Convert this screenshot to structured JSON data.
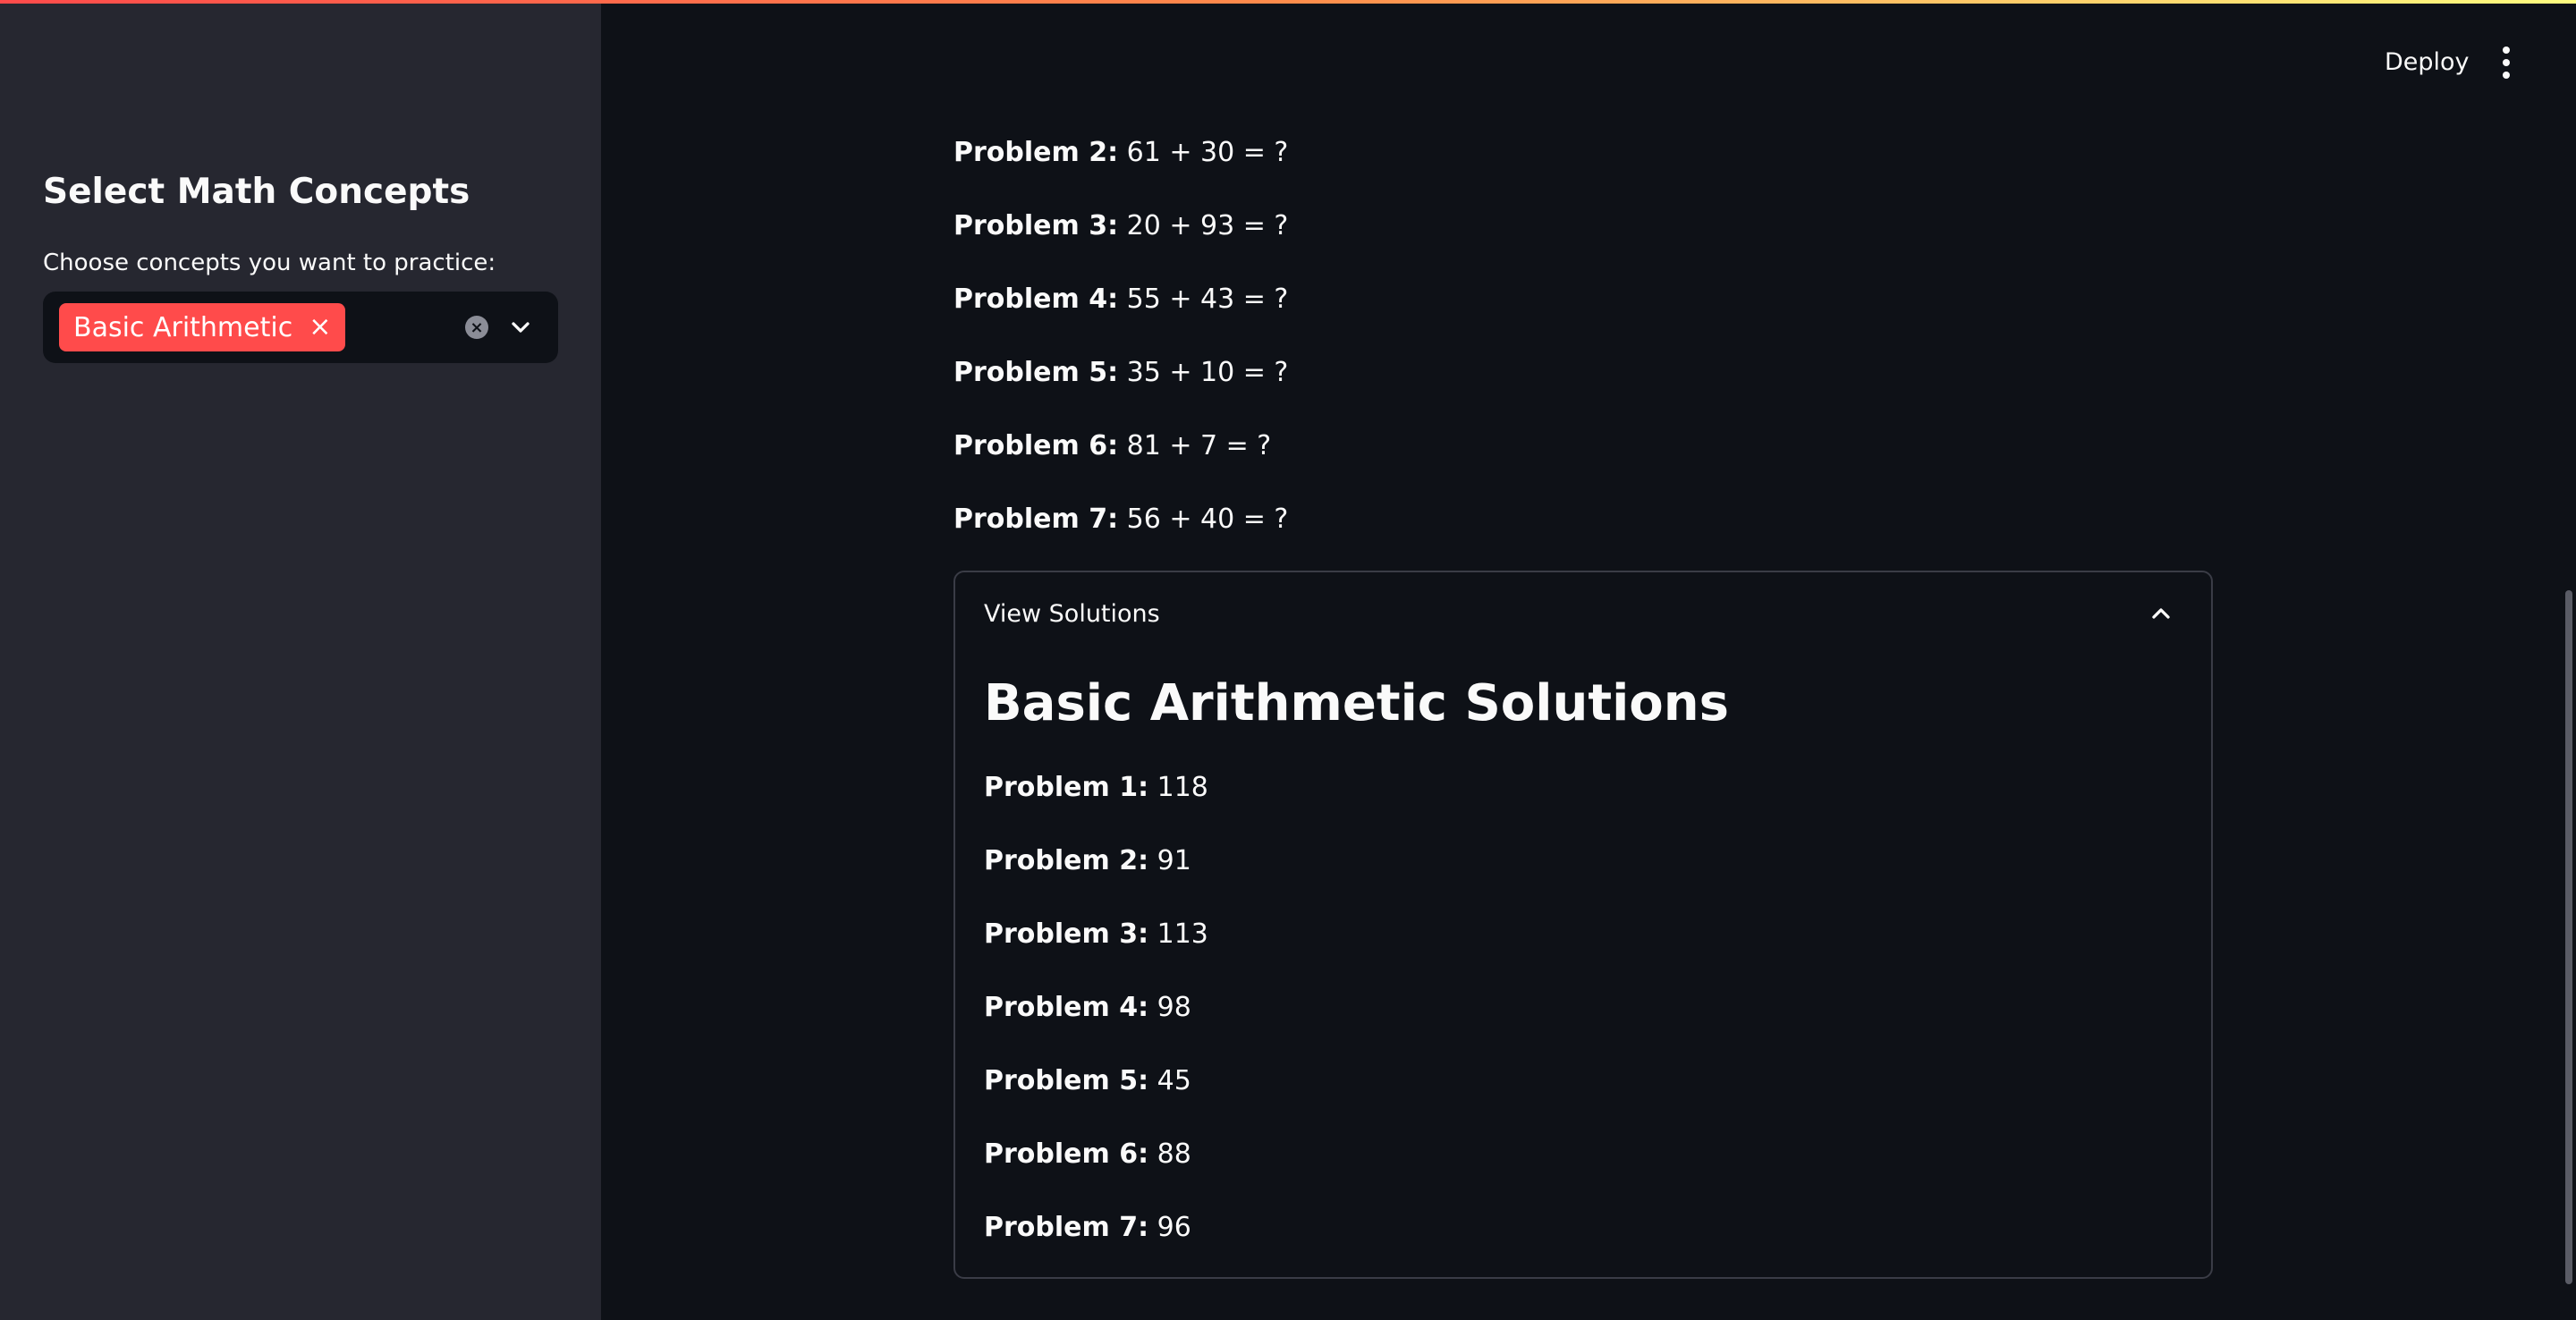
{
  "colors": {
    "accent": "#ff4b4b",
    "background": "#0e1117",
    "sidebar": "#262730"
  },
  "sidebar": {
    "title": "Select Math Concepts",
    "select_label": "Choose concepts you want to practice:",
    "selected_tags": [
      "Basic Arithmetic"
    ],
    "tag_remove_symbol": "×",
    "clear_icon": "clear-circle-icon",
    "dropdown_icon": "chevron-down-icon"
  },
  "header": {
    "deploy_label": "Deploy",
    "menu_icon": "vertical-ellipsis-icon"
  },
  "problems": [
    {
      "label": "Problem 2:",
      "text": "61 + 30 = ?"
    },
    {
      "label": "Problem 3:",
      "text": "20 + 93 = ?"
    },
    {
      "label": "Problem 4:",
      "text": "55 + 43 = ?"
    },
    {
      "label": "Problem 5:",
      "text": "35 + 10 = ?"
    },
    {
      "label": "Problem 6:",
      "text": "81 + 7 = ?"
    },
    {
      "label": "Problem 7:",
      "text": "56 + 40 = ?"
    }
  ],
  "expander": {
    "title": "View Solutions",
    "expanded": true,
    "heading": "Basic Arithmetic Solutions",
    "solutions": [
      {
        "label": "Problem 1:",
        "answer": "118"
      },
      {
        "label": "Problem 2:",
        "answer": "91"
      },
      {
        "label": "Problem 3:",
        "answer": "113"
      },
      {
        "label": "Problem 4:",
        "answer": "98"
      },
      {
        "label": "Problem 5:",
        "answer": "45"
      },
      {
        "label": "Problem 6:",
        "answer": "88"
      },
      {
        "label": "Problem 7:",
        "answer": "96"
      }
    ]
  }
}
